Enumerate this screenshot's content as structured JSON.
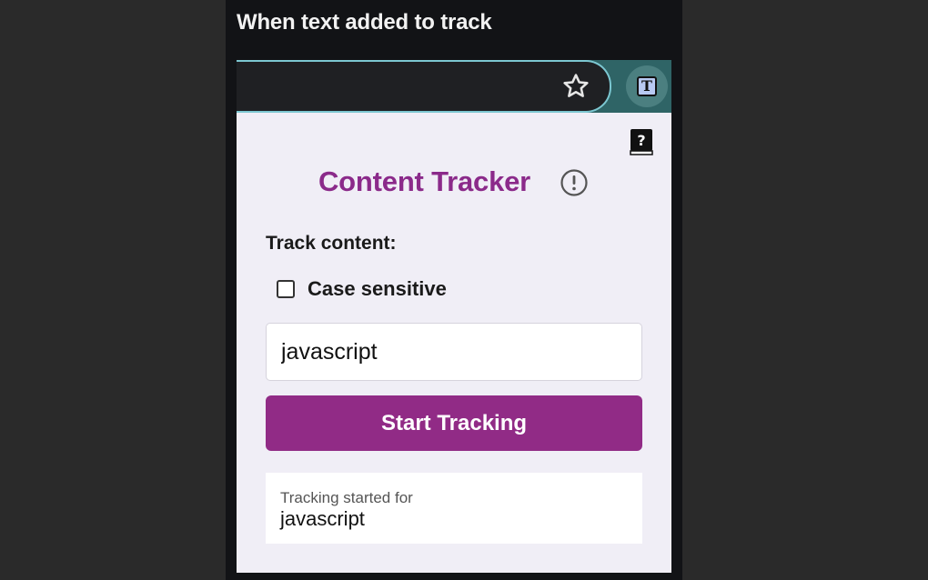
{
  "caption": "When text added to track",
  "browser": {
    "bookmark_icon": "star-icon",
    "extension_icon": "extension-t-icon",
    "extension_letter": "T",
    "accent": "#2f6466",
    "focus_ring": "#7cc7d1"
  },
  "popup": {
    "help_icon": "help-book-icon",
    "help_glyph": "?",
    "title": "Content Tracker",
    "info_icon": "exclamation-circle-icon",
    "section_label": "Track content:",
    "case_sensitive": {
      "label": "Case sensitive",
      "checked": false
    },
    "input_value": "javascript",
    "start_button_label": "Start Tracking",
    "status": {
      "label": "Tracking started for",
      "value": "javascript"
    },
    "colors": {
      "brand": "#912b86",
      "title": "#8b2a8a",
      "background": "#f0eef6"
    }
  }
}
